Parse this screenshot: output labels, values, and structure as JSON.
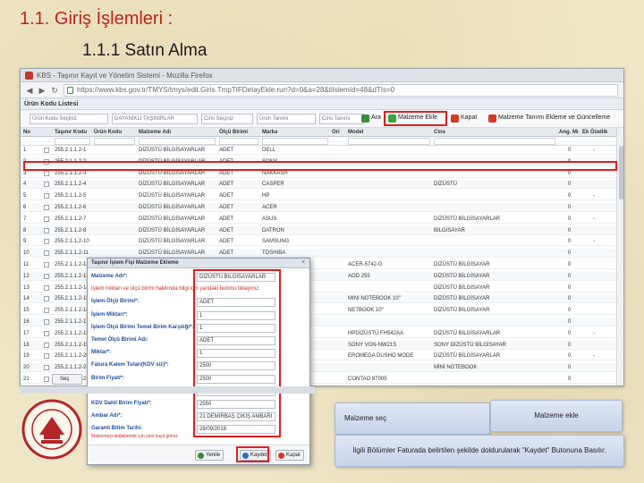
{
  "slide": {
    "title": "1.1. Giriş İşlemleri :",
    "subtitle": "1.1.1  Satın Alma"
  },
  "browser": {
    "tab_title": "KBS - Taşınır Kayıt ve Yönetim Sistemi - Mozilla Firefox",
    "url": "https://www.kbs.gov.tr/TMYS/tmys/edit.Giris.TmpTIFDetayEkle.run?d=0&a=28&tiIslemId=48&dTIs=0"
  },
  "panel": {
    "title": "Ürün Kodu Listesi"
  },
  "toolbar": {
    "filters": [
      "Ürün Kodu Seçiniz",
      "DAYANIKLI TAŞINIRLAR",
      "Cins Seçiniz",
      "Ürün Tanımı",
      "Cins Tanımı"
    ],
    "ara_label": "Ara",
    "malzeme_ekle_label": "Malzeme Ekle",
    "kapat_label": "Kapat",
    "tanim_label": "Malzeme Tanımı Ekleme ve Güncelleme"
  },
  "grid": {
    "columns": [
      "No",
      "",
      "Taşınır Kodu",
      "Ürün Kodu",
      "Malzeme Adı",
      "Ölçü Birimi",
      "Marka",
      "Ori",
      "Model",
      "Cins",
      "Ang. Mı",
      "Ek Özellik"
    ],
    "rows": [
      [
        "1",
        "255.2.1.1.2-1",
        "DİZÜSTÜ BİLGİSAYARLAR",
        "ADET",
        "DELL",
        "",
        "",
        "0",
        "-"
      ],
      [
        "2",
        "255.2.1.1.2-2",
        "DİZÜSTÜ BİLGİSAYARLAR",
        "ADET",
        "SONY",
        "",
        "",
        "0",
        "-"
      ],
      [
        "3",
        "255.2.1.1.2-3",
        "DİZÜSTÜ BİLGİSAYARLAR",
        "ADET",
        "NAKKASH",
        "",
        "",
        "0",
        ""
      ],
      [
        "4",
        "255.2.1.1.2-4",
        "DİZÜSTÜ BİLGİSAYARLAR",
        "ADET",
        "CASPER",
        "",
        "DİZÜSTÜ",
        "0",
        ""
      ],
      [
        "5",
        "255.2.1.1.2-5",
        "DİZÜSTÜ BİLGİSAYARLAR",
        "ADET",
        "HP",
        "",
        "",
        "0",
        "-"
      ],
      [
        "6",
        "255.2.1.1.2-6",
        "DİZÜSTÜ BİLGİSAYARLAR",
        "ADET",
        "ACER",
        "",
        "",
        "0",
        ""
      ],
      [
        "7",
        "255.2.1.1.2-7",
        "DİZÜSTÜ BİLGİSAYARLAR",
        "ADET",
        "ASUS",
        "",
        "DİZÜSTÜ BİLGİSAYARLAR",
        "0",
        "-"
      ],
      [
        "8",
        "255.2.1.1.2-8",
        "DİZÜSTÜ BİLGİSAYARLAR",
        "ADET",
        "DATRON",
        "",
        "BİLGİSAYAR",
        "0",
        ""
      ],
      [
        "9",
        "255.2.1.1.2-10",
        "DİZÜSTÜ BİLGİSAYARLAR",
        "ADET",
        "SAMSUNG",
        "",
        "",
        "0",
        "-"
      ],
      [
        "10",
        "255.2.1.1.2-11",
        "DİZÜSTÜ BİLGİSAYARLAR",
        "ADET",
        "TOSHIBA",
        "",
        "",
        "0",
        ""
      ],
      [
        "11",
        "255.2.1.1.2-12",
        "",
        "",
        "",
        "ACER-5742-G",
        "DİZÜSTÜ BİLGİSAYAR",
        "0",
        ""
      ],
      [
        "12",
        "255.2.1.1.2-13",
        "",
        "",
        "",
        "AOD 255",
        "DİZÜSTÜ BİLGİSAYAR",
        "0",
        ""
      ],
      [
        "13",
        "255.2.1.1.2-14",
        "",
        "",
        "",
        "",
        "DİZÜSTÜ BİLGİSAYAR",
        "0",
        ""
      ],
      [
        "14",
        "255.2.1.1.2-15",
        "",
        "",
        "",
        "MINI NOTEBOOK 10\"",
        "DİZÜSTÜ BİLGİSAYAR",
        "0",
        ""
      ],
      [
        "15",
        "255.2.1.1.2-16",
        "",
        "",
        "",
        "NETBOOK 10\"",
        "DİZÜSTÜ BİLGİSAYAR",
        "0",
        ""
      ],
      [
        "16",
        "255.2.1.1.2-17",
        "",
        "",
        "",
        "",
        "",
        "0",
        ""
      ],
      [
        "17",
        "255.2.1.1.2-18",
        "",
        "",
        "",
        "HPDİZÜSTÜ FH542AA",
        "DİZÜSTÜ BİLGİSAYARLAR",
        "0",
        "-"
      ],
      [
        "18",
        "255.2.1.1.2-19",
        "",
        "",
        "",
        "SONY VGN-NW21S",
        "SONY DİZÜSTÜ BİLGİSAYAR",
        "0",
        ""
      ],
      [
        "19",
        "255.2.1.1.2-20",
        "",
        "",
        "",
        "EROMEGA DUSHO MODE",
        "DİZÜSTÜ BİLGİSAYARLAR",
        "0",
        "-"
      ],
      [
        "20",
        "255.2.1.1.2-21",
        "",
        "",
        "",
        "",
        "MİNİ NOTEBOOK",
        "0",
        ""
      ],
      [
        "21",
        "255.2.1.1.2-22",
        "",
        "",
        "",
        "CONTAO 87005",
        "",
        "0",
        ""
      ]
    ]
  },
  "dialog": {
    "title": "Taşınır İşlem Fişi Malzeme Ekleme",
    "fields": [
      {
        "label": "Malzeme Adı*:",
        "value": "DİZÜSTÜ BİLGİSAYARLAR"
      },
      {
        "label": "İşlem miktarı ve ölçü birimi hakkında bilgi için yandaki butonu tıklayınız.",
        "value": ""
      },
      {
        "label": "İşlem Ölçü Birimi*:",
        "value": "ADET"
      },
      {
        "label": "İşlem Miktarı*:",
        "value": "1"
      },
      {
        "label": "İşlem Ölçü Birimi Temel Birim Karşılığı*:",
        "value": "1"
      },
      {
        "label": "Temel Ölçü Birimi Adı:",
        "value": "ADET"
      },
      {
        "label": "Miktar*:",
        "value": "1"
      },
      {
        "label": "Fatura Kalem Tutarı(KDV siz)*:",
        "value": "2500"
      },
      {
        "label": "Birim Fiyatı*:",
        "value": "2500"
      },
      {
        "label": "KDV Oranı*:",
        "value": "%10"
      },
      {
        "label": "KDV Dahil Birim Fiyatı*:",
        "value": "2550"
      },
      {
        "label": "Ambar Adı*:",
        "value": "21 DEMİRBAŞ ÇIKIŞ AMBARI"
      },
      {
        "label": "Garanti Bitim Tarihi:",
        "value": "28/09/2018"
      }
    ],
    "note": "Malzemeyi değiştirmek için yeni kayıt giriniz",
    "buttons": {
      "yenile": "Yenile",
      "kaydet": "Kaydet",
      "kapat": "Kapat"
    }
  },
  "bottom_button_label": "Seç",
  "callouts": {
    "select": "Malzeme seç",
    "add": "Malzeme ekle",
    "instruction": "İlgili Bölümler Faturada belirtilen şekilde doldurularak \"Kaydet\" Butonuna Basılır."
  }
}
